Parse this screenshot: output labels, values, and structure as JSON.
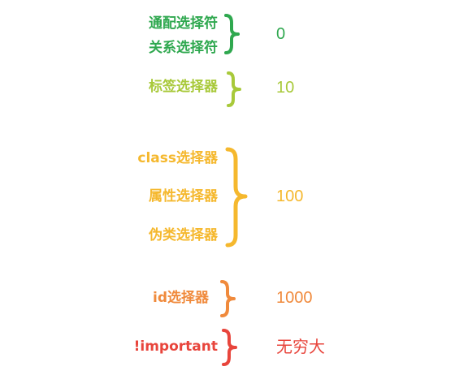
{
  "colors": {
    "universal": "#2fa84f",
    "tag": "#a8c93a",
    "class": "#f5b82e",
    "id": "#f08a3c",
    "important": "#e8453c"
  },
  "groups": [
    {
      "selectors": [
        "通配选择符",
        "关系选择符"
      ],
      "weight": "0",
      "color_key": "universal"
    },
    {
      "selectors": [
        "标签选择器"
      ],
      "weight": "10",
      "color_key": "tag"
    },
    {
      "selectors": [
        "class选择器",
        "属性选择器",
        "伪类选择器"
      ],
      "weight": "100",
      "color_key": "class"
    },
    {
      "selectors": [
        "id选择器"
      ],
      "weight": "1000",
      "color_key": "id"
    },
    {
      "selectors": [
        "!important"
      ],
      "weight": "无穷大",
      "color_key": "important"
    }
  ]
}
